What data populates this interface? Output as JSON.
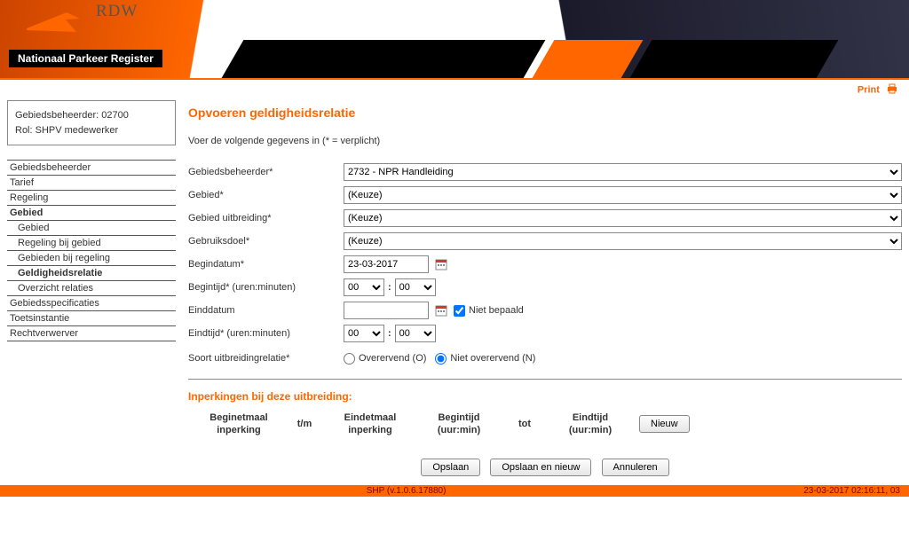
{
  "header": {
    "brand": "RDW",
    "subtitle": "Nationaal Parkeer Register"
  },
  "print_label": "Print",
  "info_box": {
    "line1": "Gebiedsbeheerder: 02700",
    "line2": "Rol: SHPV medewerker"
  },
  "nav": [
    {
      "label": "Gebiedsbeheerder",
      "sub": false,
      "selected": false
    },
    {
      "label": "Tarief",
      "sub": false,
      "selected": false
    },
    {
      "label": "Regeling",
      "sub": false,
      "selected": false
    },
    {
      "label": "Gebied",
      "sub": false,
      "selected": true
    },
    {
      "label": "Gebied",
      "sub": true,
      "selected": false
    },
    {
      "label": "Regeling bij gebied",
      "sub": true,
      "selected": false
    },
    {
      "label": "Gebieden bij regeling",
      "sub": true,
      "selected": false
    },
    {
      "label": "Geldigheidsrelatie",
      "sub": true,
      "selected": true
    },
    {
      "label": "Overzicht relaties",
      "sub": true,
      "selected": false
    },
    {
      "label": "Gebiedsspecificaties",
      "sub": false,
      "selected": false
    },
    {
      "label": "Toetsinstantie",
      "sub": false,
      "selected": false
    },
    {
      "label": "Rechtverwerver",
      "sub": false,
      "selected": false
    }
  ],
  "main": {
    "title": "Opvoeren geldigheidsrelatie",
    "instruction": "Voer de volgende gegevens in (* = verplicht)",
    "fields": {
      "gebiedsbeheerder": {
        "label": "Gebiedsbeheerder*",
        "value": "2732 - NPR Handleiding"
      },
      "gebied": {
        "label": "Gebied*",
        "value": "(Keuze)"
      },
      "gebied_uitbreiding": {
        "label": "Gebied uitbreiding*",
        "value": "(Keuze)"
      },
      "gebruiksdoel": {
        "label": "Gebruiksdoel*",
        "value": "(Keuze)"
      },
      "begindatum": {
        "label": "Begindatum*",
        "value": "23-03-2017"
      },
      "begintijd": {
        "label": "Begintijd* (uren:minuten)",
        "hh": "00",
        "mm": "00"
      },
      "einddatum": {
        "label": "Einddatum",
        "value": "",
        "niet_bepaald_label": "Niet bepaald",
        "niet_bepaald_checked": true
      },
      "eindtijd": {
        "label": "Eindtijd* (uren:minuten)",
        "hh": "00",
        "mm": "00"
      },
      "soort": {
        "label": "Soort uitbreidingrelatie*",
        "option_o": "Overervend (O)",
        "option_n": "Niet overervend (N)",
        "selected": "N"
      }
    },
    "inperkingen": {
      "header": "Inperkingen bij deze uitbreiding:",
      "cols": {
        "begin_etmaal": "Beginetmaal inperking",
        "tm": "t/m",
        "eind_etmaal": "Eindetmaal inperking",
        "begin_tijd": "Begintijd (uur:min)",
        "tot": "tot",
        "eind_tijd": "Eindtijd (uur:min)"
      },
      "nieuw_btn": "Nieuw"
    },
    "buttons": {
      "opslaan": "Opslaan",
      "opslaan_en_nieuw": "Opslaan en nieuw",
      "annuleren": "Annuleren"
    }
  },
  "footer": {
    "version": "SHP (v.1.0.6.17880)",
    "timestamp": "23-03-2017 02:16:11, 03"
  }
}
